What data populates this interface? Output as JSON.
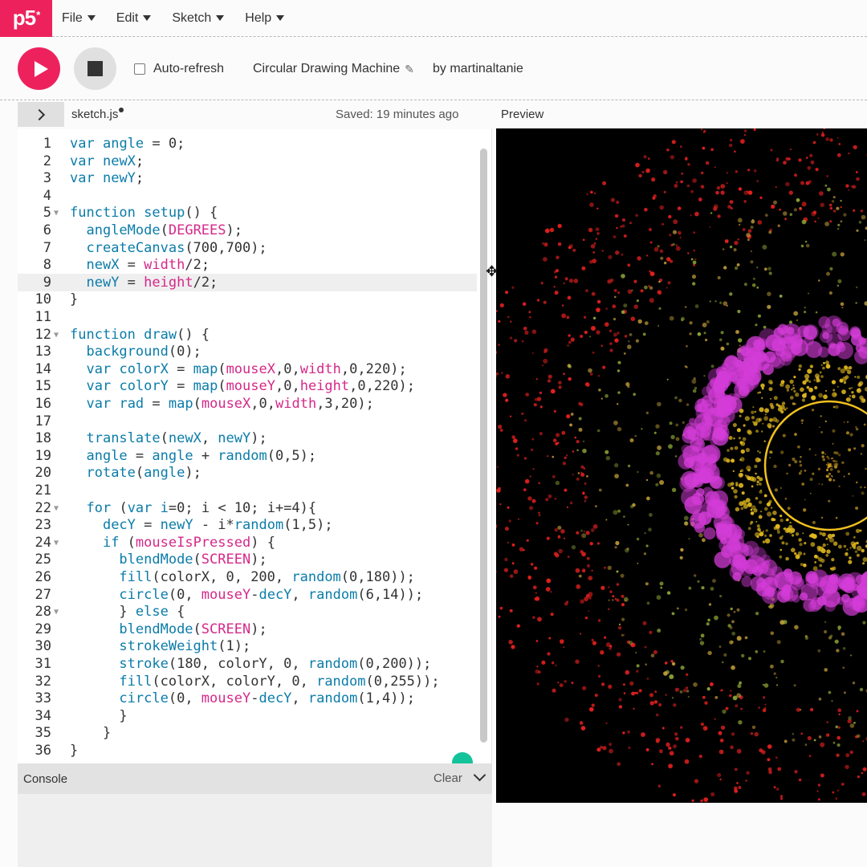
{
  "nav": {
    "logo": "p5",
    "logo_sup": "*",
    "menu": [
      {
        "label": "File"
      },
      {
        "label": "Edit"
      },
      {
        "label": "Sketch"
      },
      {
        "label": "Help"
      }
    ]
  },
  "toolbar": {
    "play_icon": "play-icon",
    "stop_icon": "stop-icon",
    "auto_refresh_label": "Auto-refresh",
    "auto_refresh_checked": false,
    "sketch_name": "Circular Drawing Machine",
    "author": "by martinaltanie"
  },
  "editor_header": {
    "file_name": "sketch.js",
    "saved_status": "Saved: 19 minutes ago",
    "preview_label": "Preview"
  },
  "code": {
    "highlighted_line": 9,
    "lines": [
      {
        "n": "1",
        "fold": false,
        "html": "<span class='kw'>var</span> <span class='fn'>angle</span> = 0;"
      },
      {
        "n": "2",
        "fold": false,
        "html": "<span class='kw'>var</span> <span class='fn'>newX</span>;"
      },
      {
        "n": "3",
        "fold": false,
        "html": "<span class='kw'>var</span> <span class='fn'>newY</span>;"
      },
      {
        "n": "4",
        "fold": false,
        "html": ""
      },
      {
        "n": "5",
        "fold": true,
        "html": "<span class='kw'>function</span> <span class='fn'>setup</span>() {"
      },
      {
        "n": "6",
        "fold": false,
        "html": "  <span class='fn'>angleMode</span>(<span class='cn'>DEGREES</span>);"
      },
      {
        "n": "7",
        "fold": false,
        "html": "  <span class='fn'>createCanvas</span>(700,700);"
      },
      {
        "n": "8",
        "fold": false,
        "html": "  <span class='fn'>newX</span> = <span class='cn'>width</span>/2;"
      },
      {
        "n": "9",
        "fold": false,
        "html": "  <span class='fn'>newY</span> = <span class='cn'>height</span>/2;"
      },
      {
        "n": "10",
        "fold": false,
        "html": "}"
      },
      {
        "n": "11",
        "fold": false,
        "html": ""
      },
      {
        "n": "12",
        "fold": true,
        "html": "<span class='kw'>function</span> <span class='fn'>draw</span>() {"
      },
      {
        "n": "13",
        "fold": false,
        "html": "  <span class='fn'>background</span>(0);"
      },
      {
        "n": "14",
        "fold": false,
        "html": "  <span class='kw'>var</span> <span class='fn'>colorX</span> = <span class='fn'>map</span>(<span class='cn'>mouseX</span>,0,<span class='cn'>width</span>,0,220);"
      },
      {
        "n": "15",
        "fold": false,
        "html": "  <span class='kw'>var</span> <span class='fn'>colorY</span> = <span class='fn'>map</span>(<span class='cn'>mouseY</span>,0,<span class='cn'>height</span>,0,220);"
      },
      {
        "n": "16",
        "fold": false,
        "html": "  <span class='kw'>var</span> <span class='fn'>rad</span> = <span class='fn'>map</span>(<span class='cn'>mouseX</span>,0,<span class='cn'>width</span>,3,20);"
      },
      {
        "n": "17",
        "fold": false,
        "html": ""
      },
      {
        "n": "18",
        "fold": false,
        "html": "  <span class='fn'>translate</span>(<span class='fn'>newX</span>, <span class='fn'>newY</span>);"
      },
      {
        "n": "19",
        "fold": false,
        "html": "  <span class='fn'>angle</span> = <span class='fn'>angle</span> + <span class='fn'>random</span>(0,5);"
      },
      {
        "n": "20",
        "fold": false,
        "html": "  <span class='fn'>rotate</span>(<span class='fn'>angle</span>);"
      },
      {
        "n": "21",
        "fold": false,
        "html": ""
      },
      {
        "n": "22",
        "fold": true,
        "html": "  <span class='kw'>for</span> (<span class='kw'>var</span> <span class='fn'>i</span>=0; i < 10; i+=4){"
      },
      {
        "n": "23",
        "fold": false,
        "html": "    <span class='fn'>decY</span> = <span class='fn'>newY</span> - i*<span class='fn'>random</span>(1,5);"
      },
      {
        "n": "24",
        "fold": true,
        "html": "    <span class='kw'>if</span> (<span class='cn'>mouseIsPressed</span>) {"
      },
      {
        "n": "25",
        "fold": false,
        "html": "      <span class='fn'>blendMode</span>(<span class='cn'>SCREEN</span>);"
      },
      {
        "n": "26",
        "fold": false,
        "html": "      <span class='fn'>fill</span>(colorX, 0, 200, <span class='fn'>random</span>(0,180));"
      },
      {
        "n": "27",
        "fold": false,
        "html": "      <span class='fn'>circle</span>(0, <span class='cn'>mouseY</span>-<span class='fn'>decY</span>, <span class='fn'>random</span>(6,14));"
      },
      {
        "n": "28",
        "fold": true,
        "html": "      } <span class='kw'>else</span> {"
      },
      {
        "n": "29",
        "fold": false,
        "html": "      <span class='fn'>blendMode</span>(<span class='cn'>SCREEN</span>);"
      },
      {
        "n": "30",
        "fold": false,
        "html": "      <span class='fn'>strokeWeight</span>(1);"
      },
      {
        "n": "31",
        "fold": false,
        "html": "      <span class='fn'>stroke</span>(180, colorY, 0, <span class='fn'>random</span>(0,200));"
      },
      {
        "n": "32",
        "fold": false,
        "html": "      <span class='fn'>fill</span>(colorX, colorY, 0, <span class='fn'>random</span>(0,255));"
      },
      {
        "n": "33",
        "fold": false,
        "html": "      <span class='fn'>circle</span>(0, <span class='cn'>mouseY</span>-<span class='fn'>decY</span>, <span class='fn'>random</span>(1,4));"
      },
      {
        "n": "34",
        "fold": false,
        "html": "      }"
      },
      {
        "n": "35",
        "fold": false,
        "html": "    }"
      },
      {
        "n": "36",
        "fold": false,
        "html": "}"
      }
    ]
  },
  "console": {
    "label": "Console",
    "clear_label": "Clear"
  },
  "colors": {
    "brand": "#ed225d",
    "keyword": "#0b7ca9",
    "constant": "#d52889"
  }
}
